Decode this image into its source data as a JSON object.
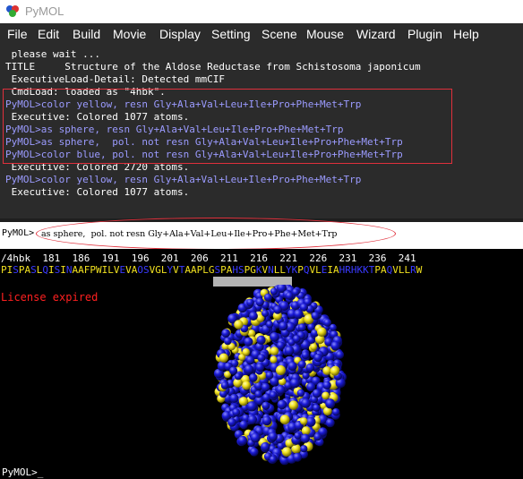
{
  "window": {
    "title": "PyMOL"
  },
  "menu": [
    "File",
    "Edit",
    "Build",
    "Movie",
    "Display",
    "Setting",
    "Scene",
    "Mouse",
    "Wizard",
    "Plugin",
    "Help"
  ],
  "console_lines": [
    {
      "text": " please wait ...",
      "color": "#ffffff"
    },
    {
      "text": "TITLE     Structure of the Aldose Reductase from Schistosoma japonicum",
      "color": "#ffffff"
    },
    {
      "text": " ExecutiveLoad-Detail: Detected mmCIF",
      "color": "#ffffff"
    },
    {
      "text": " CmdLoad: loaded as \"4hbk\".",
      "color": "#ffffff"
    },
    {
      "text": "PyMOL>color yellow, resn Gly+Ala+Val+Leu+Ile+Pro+Phe+Met+Trp",
      "color": "#9b9bff"
    },
    {
      "text": " Executive: Colored 1077 atoms.",
      "color": "#ffffff"
    },
    {
      "text": "PyMOL>as sphere, resn Gly+Ala+Val+Leu+Ile+Pro+Phe+Met+Trp",
      "color": "#9b9bff"
    },
    {
      "text": "PyMOL>as sphere,  pol. not resn Gly+Ala+Val+Leu+Ile+Pro+Phe+Met+Trp",
      "color": "#9b9bff"
    },
    {
      "text": "PyMOL>color blue, pol. not resn Gly+Ala+Val+Leu+Ile+Pro+Phe+Met+Trp",
      "color": "#9b9bff"
    },
    {
      "text": " Executive: Colored 2720 atoms.",
      "color": "#ffffff"
    },
    {
      "text": "PyMOL>color yellow, resn Gly+Ala+Val+Leu+Ile+Pro+Phe+Met+Trp",
      "color": "#9b9bff"
    },
    {
      "text": " Executive: Colored 1077 atoms.",
      "color": "#ffffff"
    }
  ],
  "command": {
    "prompt": "PyMOL>",
    "text": "as sphere,  pol. not resn Gly+Ala+Val+Leu+Ile+Pro+Phe+Met+Trp"
  },
  "sequence": {
    "header": "/4hbk  181  186  191  196  201  206  211  216  221  226  231  236  241",
    "residues": "PISPASLQISINAAFPWILVEVAOSVGLYVTAAPLGSPAHSPGKVNLLYKPQVLEIAHRHKKTPAQVLLRW"
  },
  "license_text": "License expired",
  "bottom_prompt": "PyMOL>_",
  "colors": {
    "highlight": "#e0303c",
    "sphere_blue": "#1a1ad6",
    "sphere_yellow": "#f0e020"
  }
}
